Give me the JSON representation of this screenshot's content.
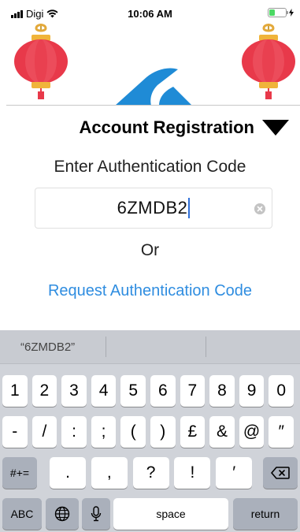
{
  "status_bar": {
    "carrier": "Digi",
    "time": "10:06 AM",
    "battery_level": 0.35
  },
  "icons": {
    "signal": "signal-bars-icon",
    "wifi": "wifi-icon",
    "battery": "battery-icon",
    "charging": "charging-bolt-icon",
    "lantern": "lantern-icon",
    "logo": "app-logo-icon",
    "caret": "triangle-down-icon",
    "clear": "clear-text-icon",
    "backspace": "backspace-icon",
    "globe": "globe-icon",
    "mic": "microphone-icon"
  },
  "colors": {
    "link": "#2f8de0",
    "lantern_red": "#e8394a",
    "lantern_gold": "#f0b43a",
    "logo_blue": "#1f8bd6",
    "cursor": "#2f6fd8"
  },
  "page": {
    "title": "Account Registration",
    "auth_label": "Enter Authentication Code",
    "code_value": "6ZMDB2",
    "or_label": "Or",
    "request_link": "Request Authentication Code"
  },
  "keyboard": {
    "suggestion": "“6ZMDB2”",
    "row1": [
      "1",
      "2",
      "3",
      "4",
      "5",
      "6",
      "7",
      "8",
      "9",
      "0"
    ],
    "row2": [
      "-",
      "/",
      ":",
      ";",
      "(",
      ")",
      "£",
      "&",
      "@",
      "″"
    ],
    "row3_mode": "#+=",
    "row3": [
      ".",
      ",",
      "?",
      "!",
      "′"
    ],
    "abc_label": "ABC",
    "space_label": "space",
    "return_label": "return"
  }
}
